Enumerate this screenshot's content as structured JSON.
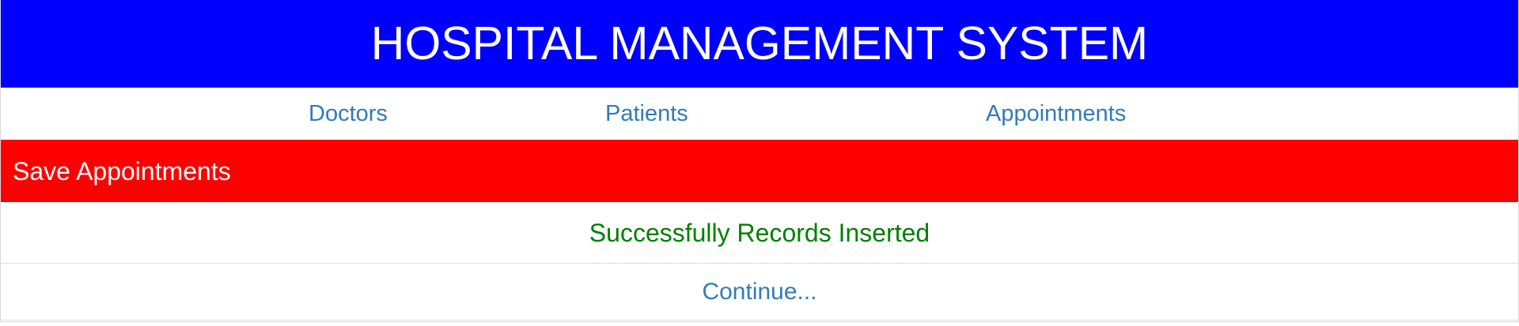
{
  "header": {
    "title": "HOSPITAL MANAGEMENT SYSTEM"
  },
  "nav": {
    "items": [
      {
        "label": "Doctors"
      },
      {
        "label": "Patients"
      },
      {
        "label": "Appointments"
      }
    ]
  },
  "panel": {
    "heading": "Save Appointments",
    "message": "Successfully Records Inserted",
    "continue_label": "Continue..."
  },
  "colors": {
    "header_bg": "#0000ff",
    "panel_heading_bg": "#ff0000",
    "link": "#337ab7",
    "success": "#008000"
  }
}
